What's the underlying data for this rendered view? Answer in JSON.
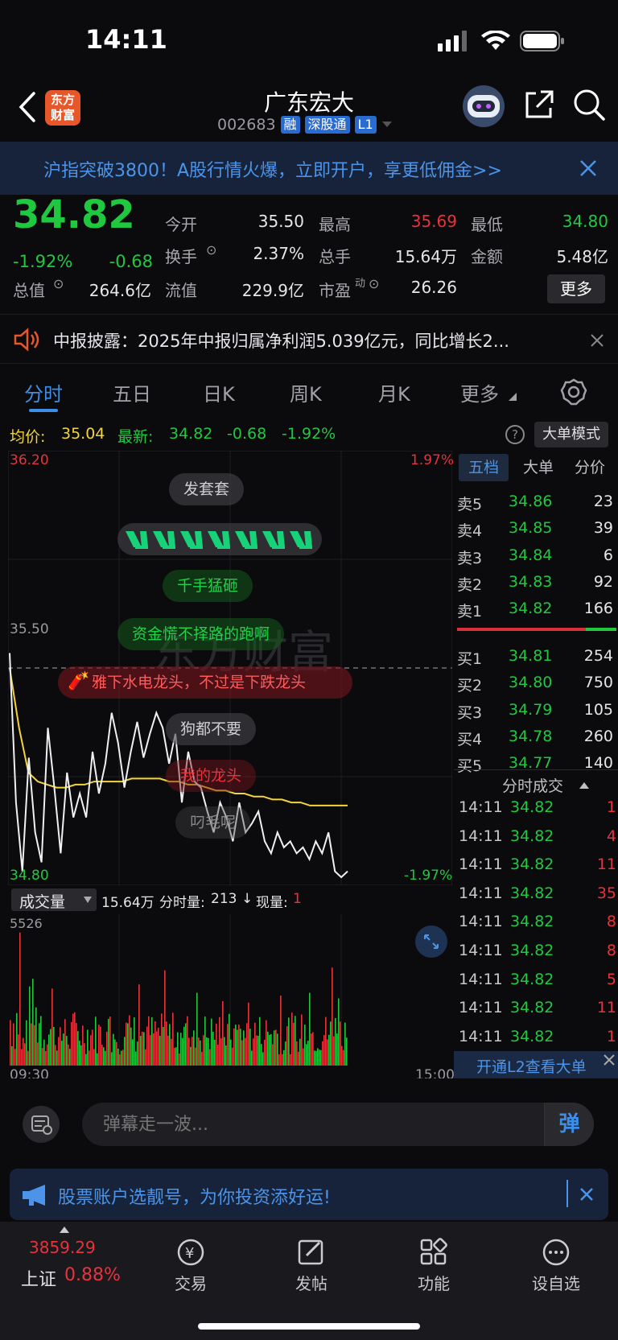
{
  "status_bar": {
    "time": "14:11"
  },
  "header": {
    "logo_line1": "东方",
    "logo_line2": "财富",
    "title": "广东宏大",
    "code": "002683",
    "tags": [
      "融",
      "深股通",
      "L1"
    ]
  },
  "banner": {
    "text": "沪指突破3800！A股行情火爆，立即开户，享更低佣金>>"
  },
  "quote": {
    "price": "34.82",
    "change_pct": "-1.92%",
    "change": "-0.68",
    "open_label": "今开",
    "open": "35.50",
    "high_label": "最高",
    "high": "35.69",
    "low_label": "最低",
    "low": "34.80",
    "turnover_label": "换手",
    "turnover": "2.37%",
    "volume_label": "总手",
    "volume": "15.64万",
    "amount_label": "金额",
    "amount": "5.48亿",
    "mktcap_label": "总值",
    "mktcap": "264.6亿",
    "float_label": "流值",
    "float": "229.9亿",
    "pe_label": "市盈",
    "pe_sup": "动",
    "pe": "26.26",
    "more_label": "更多"
  },
  "notice": {
    "text": "中报披露：2025年中报归属净利润5.039亿元，同比增长2..."
  },
  "tabs": [
    {
      "label": "分时"
    },
    {
      "label": "五日"
    },
    {
      "label": "日K"
    },
    {
      "label": "周K"
    },
    {
      "label": "月K"
    },
    {
      "label": "更多"
    }
  ],
  "info_row": {
    "avg_label": "均价:",
    "avg": "35.04",
    "latest_label": "最新:",
    "latest": "34.82",
    "latest_change": "-0.68",
    "latest_pct": "-1.92%",
    "mode_label": "大单模式"
  },
  "chart": {
    "y_high": "36.20",
    "y_mid": "35.50",
    "y_low": "34.80",
    "pct_high": "1.97%",
    "pct_low": "-1.97%",
    "time_start": "09:30",
    "time_end": "15:00",
    "watermark": "东方财富"
  },
  "chart_data": {
    "type": "line",
    "ylim": [
      34.8,
      36.2
    ],
    "prev_close": 35.5,
    "series": [
      {
        "name": "最新",
        "values": [
          35.55,
          35.05,
          34.82,
          35.2,
          34.95,
          34.85,
          35.3,
          35.1,
          34.88,
          35.15,
          35.0,
          35.08,
          35.0,
          35.22,
          35.08,
          35.18,
          35.35,
          35.25,
          35.1,
          35.22,
          35.32,
          35.2,
          35.28,
          35.35,
          35.3,
          35.18,
          35.28,
          35.05,
          35.22,
          35.12,
          35.1,
          35.02,
          34.95,
          35.05,
          35.0,
          34.92,
          35.05,
          34.95,
          34.98,
          35.02,
          34.92,
          34.88,
          34.95,
          34.9,
          34.92,
          34.88,
          34.9,
          34.86,
          34.92,
          34.88,
          34.95,
          34.82,
          34.8,
          34.82
        ]
      },
      {
        "name": "均价",
        "values": [
          35.5,
          35.3,
          35.15,
          35.12,
          35.11,
          35.1,
          35.1,
          35.11,
          35.11,
          35.12,
          35.12,
          35.12,
          35.12,
          35.13,
          35.13,
          35.13,
          35.13,
          35.12,
          35.12,
          35.11,
          35.11,
          35.1,
          35.09,
          35.09,
          35.08,
          35.08,
          35.07,
          35.07,
          35.06,
          35.06,
          35.05,
          35.05,
          35.04,
          35.04,
          35.04,
          35.04,
          35.04
        ]
      }
    ],
    "volume": {
      "max_label": "5526",
      "values": [
        5526
      ]
    }
  },
  "bubbles": [
    "发套套",
    "千手猛砸",
    "资金慌不择路的跑啊",
    "雅下水电龙头，不过是下跌龙头",
    "狗都不要",
    "我的龙头",
    "叼毛呢"
  ],
  "vol_bar": {
    "select_label": "成交量",
    "total": "15.64万",
    "tick_label": "分时量:",
    "tick": "213",
    "now_label": "现量:",
    "now": "1"
  },
  "book": {
    "tabs": [
      "五档",
      "大单",
      "分价"
    ],
    "asks": [
      {
        "label": "卖5",
        "price": "34.86",
        "qty": "23"
      },
      {
        "label": "卖4",
        "price": "34.85",
        "qty": "39"
      },
      {
        "label": "卖3",
        "price": "34.84",
        "qty": "6"
      },
      {
        "label": "卖2",
        "price": "34.83",
        "qty": "92"
      },
      {
        "label": "卖1",
        "price": "34.82",
        "qty": "166"
      }
    ],
    "bids": [
      {
        "label": "买1",
        "price": "34.81",
        "qty": "254"
      },
      {
        "label": "买2",
        "price": "34.80",
        "qty": "750"
      },
      {
        "label": "买3",
        "price": "34.79",
        "qty": "105"
      },
      {
        "label": "买4",
        "price": "34.78",
        "qty": "260"
      },
      {
        "label": "买5",
        "price": "34.77",
        "qty": "140"
      }
    ],
    "trades_title": "分时成交",
    "trades": [
      {
        "time": "14:11",
        "price": "34.82",
        "qty": "1"
      },
      {
        "time": "14:11",
        "price": "34.82",
        "qty": "4"
      },
      {
        "time": "14:11",
        "price": "34.82",
        "qty": "11"
      },
      {
        "time": "14:11",
        "price": "34.82",
        "qty": "35"
      },
      {
        "time": "14:11",
        "price": "34.82",
        "qty": "8"
      },
      {
        "time": "14:11",
        "price": "34.82",
        "qty": "8"
      },
      {
        "time": "14:11",
        "price": "34.82",
        "qty": "5"
      },
      {
        "time": "14:11",
        "price": "34.82",
        "qty": "11"
      },
      {
        "time": "14:11",
        "price": "34.82",
        "qty": "1"
      }
    ],
    "l2_label": "开通L2查看大单"
  },
  "comment": {
    "placeholder": "弹幕走一波...",
    "send_label": "弹"
  },
  "promo": {
    "text": "股票账户选靓号，为你投资添好运!"
  },
  "bottom_nav": {
    "index_value": "3859.29",
    "index_name": "上证",
    "index_pct": "0.88%",
    "items": [
      "交易",
      "发帖",
      "功能",
      "设自选"
    ]
  },
  "colors": {
    "up": "#e8323c",
    "down": "#20c840",
    "accent": "#3d8ee8",
    "avg_line": "#f2d53c"
  }
}
